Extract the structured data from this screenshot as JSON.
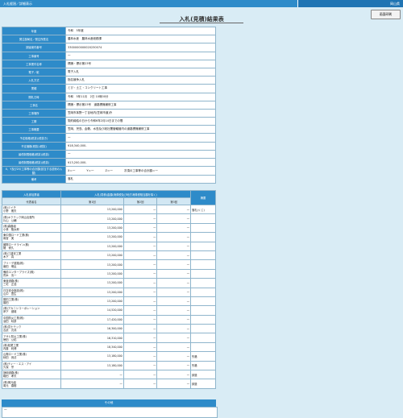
{
  "header": {
    "left": "入札経過／詳細表示",
    "right": "岡山県"
  },
  "print_button": "画面印刷",
  "title": "入札(見積)結果表",
  "info_rows": [
    {
      "label": "年度",
      "value": "令和　5年度"
    },
    {
      "label": "発注部局名／発注所属名",
      "value": "農林水産　農林水産総務課"
    },
    {
      "label": "調達案件番号",
      "value": "3300000000020230074"
    },
    {
      "label": "工事番号",
      "value": "一"
    },
    {
      "label": "工事業件名称",
      "value": "標識・標示第23号"
    },
    {
      "label": "電子／紙",
      "value": "電子入札"
    },
    {
      "label": "入札方式",
      "value": "指名競争入札"
    },
    {
      "label": "業種",
      "value": "とび・土工・コンクリート工事"
    },
    {
      "label": "開札日時",
      "value": "令和　5年11月　2日 10時00分"
    },
    {
      "label": "工事名",
      "value": "標識・標示第23号　道路標識補修工事"
    },
    {
      "label": "工事場所",
      "value": "笠岡市茅野一丁目地内(笠岡市道)外"
    },
    {
      "label": "工期",
      "value": "契約締結の日から令和6年2月14日までの間"
    },
    {
      "label": "工事概要",
      "value": "笠岡、児島、倉敷、水島及び総社署管轄管内の道路標識補修工事"
    },
    {
      "label": "予定価格(税抜)(税抜き)",
      "value": "一"
    },
    {
      "label": "予定価格(税抜)(税抜)",
      "value": "¥18,340,000-"
    },
    {
      "label": "最低制限価格(税抜)(税抜)",
      "value": "一"
    },
    {
      "label": "最低制限価格(税抜)(税抜)",
      "value": "¥13,200,000-"
    },
    {
      "label": "X、Y及びZの工事等の合計額(該当する技術の入替)",
      "value": "X＝一　　　　Y＝一　　　　Z＝一　　　　次項の工事等の合計額＝一"
    },
    {
      "label": "備考",
      "value": "落札"
    }
  ],
  "bid_table": {
    "col_company": "入札参加業者",
    "col_rep": "代表者名",
    "col_amount": "入札(見積)金額(消費税及び地方消費税相当額を除く)",
    "col_round1": "第1回",
    "col_round2": "第2回",
    "col_round3": "第3回",
    "col_remarks": "摘要",
    "rows": [
      {
        "company": "(株)ミイチ",
        "rep": "小野　雅夫",
        "r1": "13,200,000",
        "r2": "一",
        "r3": "一",
        "remark": "落札(くじ)"
      },
      {
        "company": "(株)キクテック岡山出張所",
        "rep": "片山　公輔",
        "r1": "13,200,000",
        "r2": "一",
        "r3": "一",
        "remark": ""
      },
      {
        "company": "(株)森藤組",
        "rep": "小林　隆太郎",
        "r1": "13,200,000",
        "r2": "一",
        "r3": "一",
        "remark": ""
      },
      {
        "company": "東中国ロード工業(株)",
        "rep": "雨宮　実",
        "r1": "13,200,000",
        "r2": "一",
        "r3": "一",
        "remark": ""
      },
      {
        "company": "國際ロードライン(株)",
        "rep": "猪　修久",
        "r1": "13,200,000",
        "r2": "一",
        "r3": "一",
        "remark": ""
      },
      {
        "company": "(株)三建安工業",
        "rep": "木下　真",
        "r1": "13,200,000",
        "r2": "一",
        "r3": "一",
        "remark": ""
      },
      {
        "company": "ブリーデ道路(株)",
        "rep": "番田　明弘",
        "r1": "13,200,000",
        "r2": "一",
        "r3": "一",
        "remark": ""
      },
      {
        "company": "備前エンタープライズ(株)",
        "rep": "荒木　清一",
        "r1": "13,200,000",
        "r2": "一",
        "r3": "一",
        "remark": ""
      },
      {
        "company": "東亜道路(株)",
        "rep": "三宅　正浩",
        "r1": "13,200,000",
        "r2": "一",
        "r3": "一",
        "remark": ""
      },
      {
        "company": "日交安全施設(株)",
        "rep": "山中　豊生",
        "r1": "13,200,000",
        "r2": "一",
        "r3": "一",
        "remark": ""
      },
      {
        "company": "藤田工業(株)",
        "rep": "藤田",
        "r1": "13,200,000",
        "r2": "一",
        "r3": "一",
        "remark": ""
      },
      {
        "company": "(株)アカニシコーポレーション",
        "rep": "岸下　健雄",
        "r1": "14,520,000",
        "r2": "一",
        "r3": "一",
        "remark": ""
      },
      {
        "company": "中国防災工業(株)",
        "rep": "濱田　晴彦",
        "r1": "17,420,000",
        "r2": "一",
        "r3": "一",
        "remark": ""
      },
      {
        "company": "(株)富士テック",
        "rep": "吉武　元成",
        "r1": "16,300,000",
        "r2": "一",
        "r3": "一",
        "remark": ""
      },
      {
        "company": "アサヒ防災工業(株)",
        "rep": "徳田　公佑",
        "r1": "16,310,000",
        "r2": "一",
        "r3": "一",
        "remark": ""
      },
      {
        "company": "(株)松尾工業",
        "rep": "内藤　利博",
        "r1": "18,340,000",
        "r2": "一",
        "r3": "一",
        "remark": ""
      },
      {
        "company": "山陽ロード工業(株)",
        "rep": "秋田　良法",
        "r1": "13,180,000",
        "r2": "一",
        "r3": "一",
        "remark": "失格"
      },
      {
        "company": "(株)ティー・エス・アイ",
        "rep": "久保　宗",
        "r1": "13,180,000",
        "r2": "一",
        "r3": "一",
        "remark": "失格"
      },
      {
        "company": "静岡道路(株)",
        "rep": "箱田　孝夫",
        "r1": "一",
        "r2": "一",
        "r3": "一",
        "remark": "辞退"
      },
      {
        "company": "(株)萬元組",
        "rep": "萬元　春樹",
        "r1": "一",
        "r2": "一",
        "r3": "一",
        "remark": "辞退"
      }
    ]
  },
  "other": {
    "header": "その他",
    "body": "一"
  },
  "colors": {
    "accent": "#2e8bc9",
    "background": "#d9ecf5"
  }
}
